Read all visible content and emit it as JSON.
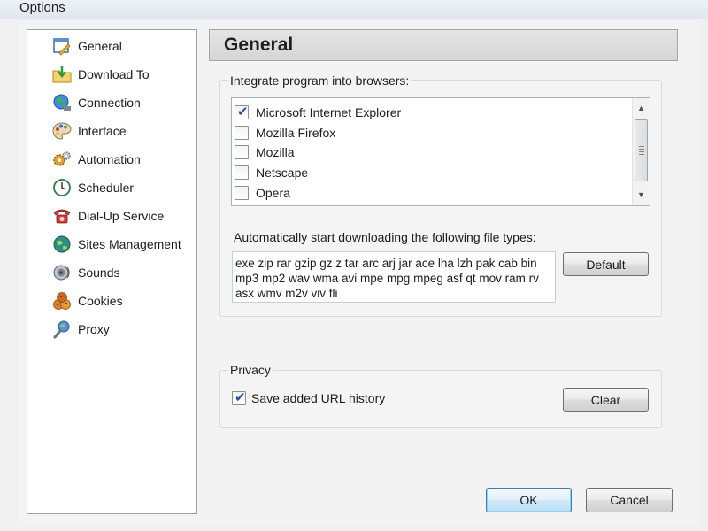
{
  "window": {
    "title": "Options"
  },
  "sidebar": {
    "items": [
      {
        "label": "General",
        "icon": "general-settings-icon"
      },
      {
        "label": "Download To",
        "icon": "download-folder-icon"
      },
      {
        "label": "Connection",
        "icon": "globe-connection-icon"
      },
      {
        "label": "Interface",
        "icon": "palette-icon"
      },
      {
        "label": "Automation",
        "icon": "gears-icon"
      },
      {
        "label": "Scheduler",
        "icon": "clock-icon"
      },
      {
        "label": "Dial-Up Service",
        "icon": "telephone-icon"
      },
      {
        "label": "Sites Management",
        "icon": "globe-sites-icon"
      },
      {
        "label": "Sounds",
        "icon": "speaker-icon"
      },
      {
        "label": "Cookies",
        "icon": "cookies-icon"
      },
      {
        "label": "Proxy",
        "icon": "proxy-icon"
      }
    ],
    "selected": "General"
  },
  "main": {
    "title": "General",
    "browsers": {
      "label": "Integrate program into browsers:",
      "items": [
        {
          "label": "Microsoft Internet Explorer",
          "checked": true
        },
        {
          "label": "Mozilla Firefox",
          "checked": false
        },
        {
          "label": "Mozilla",
          "checked": false
        },
        {
          "label": "Netscape",
          "checked": false
        },
        {
          "label": "Opera",
          "checked": false
        }
      ]
    },
    "filetypes": {
      "label": "Automatically start downloading the following file types:",
      "value": "exe zip rar gzip gz z tar arc arj jar ace lha lzh pak cab bin mp3 mp2 wav wma avi mpe mpg mpeg asf qt mov ram rv asx wmv m2v viv fli",
      "default_button": "Default"
    },
    "privacy": {
      "label": "Privacy",
      "history_label": "Save added URL history",
      "history_checked": true,
      "clear_button": "Clear"
    }
  },
  "footer": {
    "ok": "OK",
    "cancel": "Cancel"
  },
  "colors": {
    "accent_button_border": "#3c7fb1",
    "checkmark": "#2a4f9a",
    "header_bg": "#dcdcdc"
  }
}
